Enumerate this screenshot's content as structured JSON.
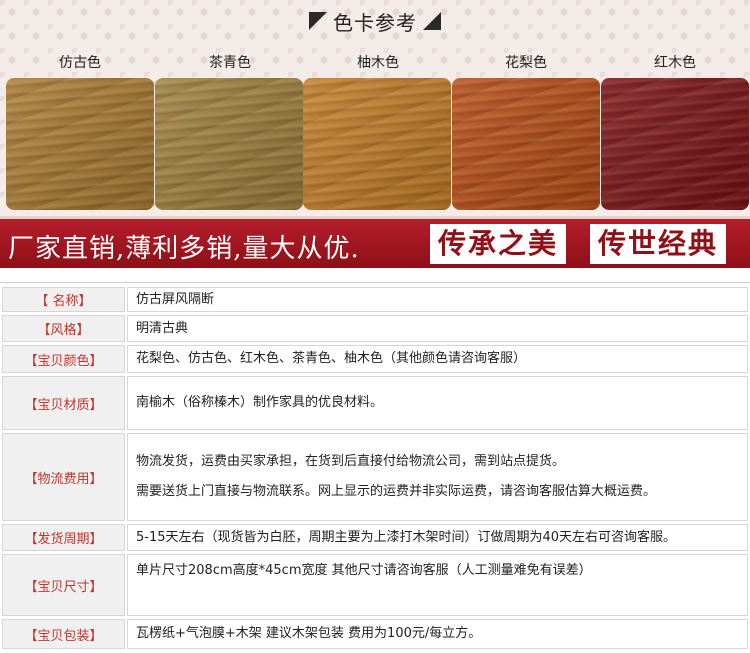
{
  "heading": "色卡参考",
  "swatches": [
    {
      "label": "仿古色",
      "color": "#a8792f"
    },
    {
      "label": "茶青色",
      "color": "#9d7e3a"
    },
    {
      "label": "柚木色",
      "color": "#c27a23"
    },
    {
      "label": "花梨色",
      "color": "#b84a12"
    },
    {
      "label": "红木色",
      "color": "#7a0e12"
    }
  ],
  "banner": {
    "slogan": "厂家直销,薄利多销,量大从优.",
    "seal1": "传承之美",
    "seal2": "传世经典"
  },
  "specs": [
    {
      "label": "【 名称】",
      "lines": [
        "仿古屏风隔断"
      ]
    },
    {
      "label": "【风格】",
      "lines": [
        "明清古典"
      ]
    },
    {
      "label": "【宝贝颜色】",
      "lines": [
        "花梨色、仿古色、红木色、茶青色、柚木色（其他颜色请咨询客服）"
      ]
    },
    {
      "label": "【宝贝材质】",
      "lines": [
        "南榆木（俗称榛木）制作家具的优良材料。"
      ]
    },
    {
      "label": "【物流费用】",
      "lines": [
        "物流发货，运费由买家承担，在货到后直接付给物流公司，需到站点提货。",
        "需要送货上门直接与物流联系。网上显示的运费并非实际运费，请咨询客服估算大概运费。"
      ]
    },
    {
      "label": "【发货周期】",
      "lines": [
        "5-15天左右（现货皆为白胚，周期主要为上漆打木架时间）订做周期为40天左右可咨询客服。"
      ]
    },
    {
      "label": "【宝贝尺寸】",
      "lines": [
        "单片尺寸208cm高度*45cm宽度 其他尺寸请咨询客服（人工测量难免有误差）"
      ]
    },
    {
      "label": "【宝贝包装】",
      "lines": [
        "瓦楞纸+气泡膜+木架  建议木架包装 费用为100元/每立方。"
      ]
    }
  ]
}
